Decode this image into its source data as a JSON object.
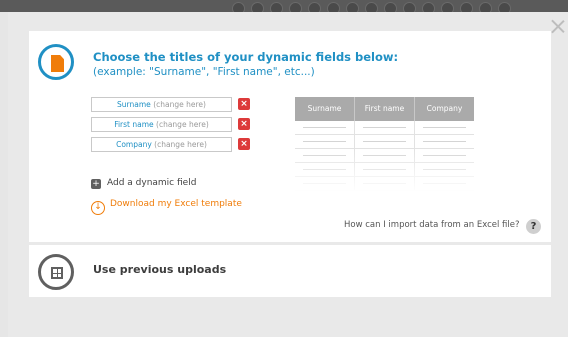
{
  "header": {
    "title": "Choose the titles of your dynamic fields below:",
    "subtitle": "(example: \"Surname\", \"First name\", etc...)"
  },
  "fields": [
    {
      "name": "Surname",
      "hint": "(change here)"
    },
    {
      "name": "First name",
      "hint": "(change here)"
    },
    {
      "name": "Company",
      "hint": "(change here)"
    }
  ],
  "preview_table": {
    "columns": [
      "Surname",
      "First name",
      "Company"
    ]
  },
  "actions": {
    "add_field": "Add a dynamic field",
    "download_template": "Download my Excel template"
  },
  "help": {
    "text": "How can I import data from an Excel file?",
    "icon": "?"
  },
  "previous_uploads": {
    "label": "Use previous uploads"
  },
  "icons": {
    "delete": "×",
    "plus": "+",
    "download": "↓"
  },
  "colors": {
    "accent": "#2090c4",
    "orange": "#f07d0a",
    "delete": "#dd3a3a"
  }
}
